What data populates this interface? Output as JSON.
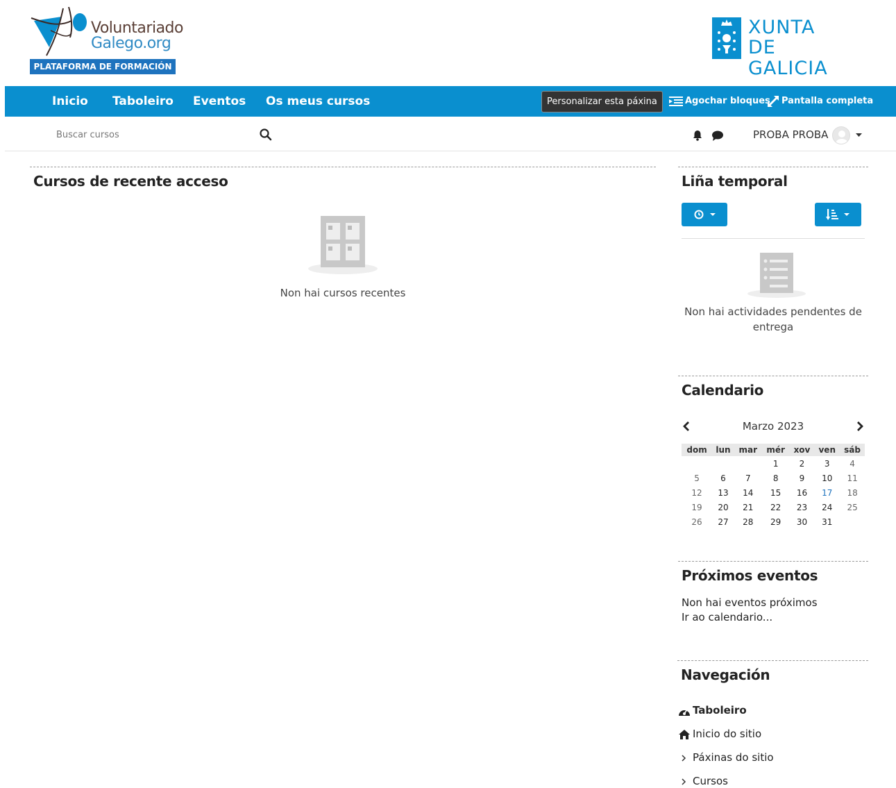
{
  "header": {
    "logo_left": {
      "line1": "Voluntariado",
      "line2": "Galego.org",
      "subtitle": "PLATAFORMA DE FORMACIÓN"
    },
    "logo_right": {
      "line1": "XUNTA",
      "line2": "DE GALICIA"
    }
  },
  "navbar": {
    "items": [
      "Inicio",
      "Taboleiro",
      "Eventos",
      "Os meus cursos"
    ],
    "customize_label": "Personalizar esta páxina",
    "hide_blocks_label": "Agochar bloques",
    "fullscreen_label": "Pantalla completa"
  },
  "search": {
    "placeholder": "Buscar cursos"
  },
  "user": {
    "name": "PROBA PROBA"
  },
  "recent_courses": {
    "title": "Cursos de recente acceso",
    "empty_text": "Non hai cursos recentes"
  },
  "timeline": {
    "title": "Liña temporal",
    "empty_text_line1": "Non hai actividades pendentes de",
    "empty_text_line2": "entrega"
  },
  "calendar": {
    "title": "Calendario",
    "month": "Marzo 2023",
    "weekdays": [
      "dom",
      "lun",
      "mar",
      "mér",
      "xov",
      "ven",
      "sáb"
    ],
    "weeks": [
      [
        "",
        "",
        "",
        "1",
        "2",
        "3",
        "4"
      ],
      [
        "5",
        "6",
        "7",
        "8",
        "9",
        "10",
        "11"
      ],
      [
        "12",
        "13",
        "14",
        "15",
        "16",
        "17",
        "18"
      ],
      [
        "19",
        "20",
        "21",
        "22",
        "23",
        "24",
        "25"
      ],
      [
        "26",
        "27",
        "28",
        "29",
        "30",
        "31",
        ""
      ]
    ]
  },
  "upcoming": {
    "title": "Próximos eventos",
    "empty_text": "Non hai eventos próximos",
    "calendar_link": "Ir ao calendario..."
  },
  "navigation": {
    "title": "Navegación",
    "items": [
      "Taboleiro",
      "Inicio do sitio",
      "Páxinas do sitio",
      "Cursos"
    ]
  },
  "colors": {
    "primary": "#0a8fcf",
    "logo_blue": "#1e73be"
  }
}
